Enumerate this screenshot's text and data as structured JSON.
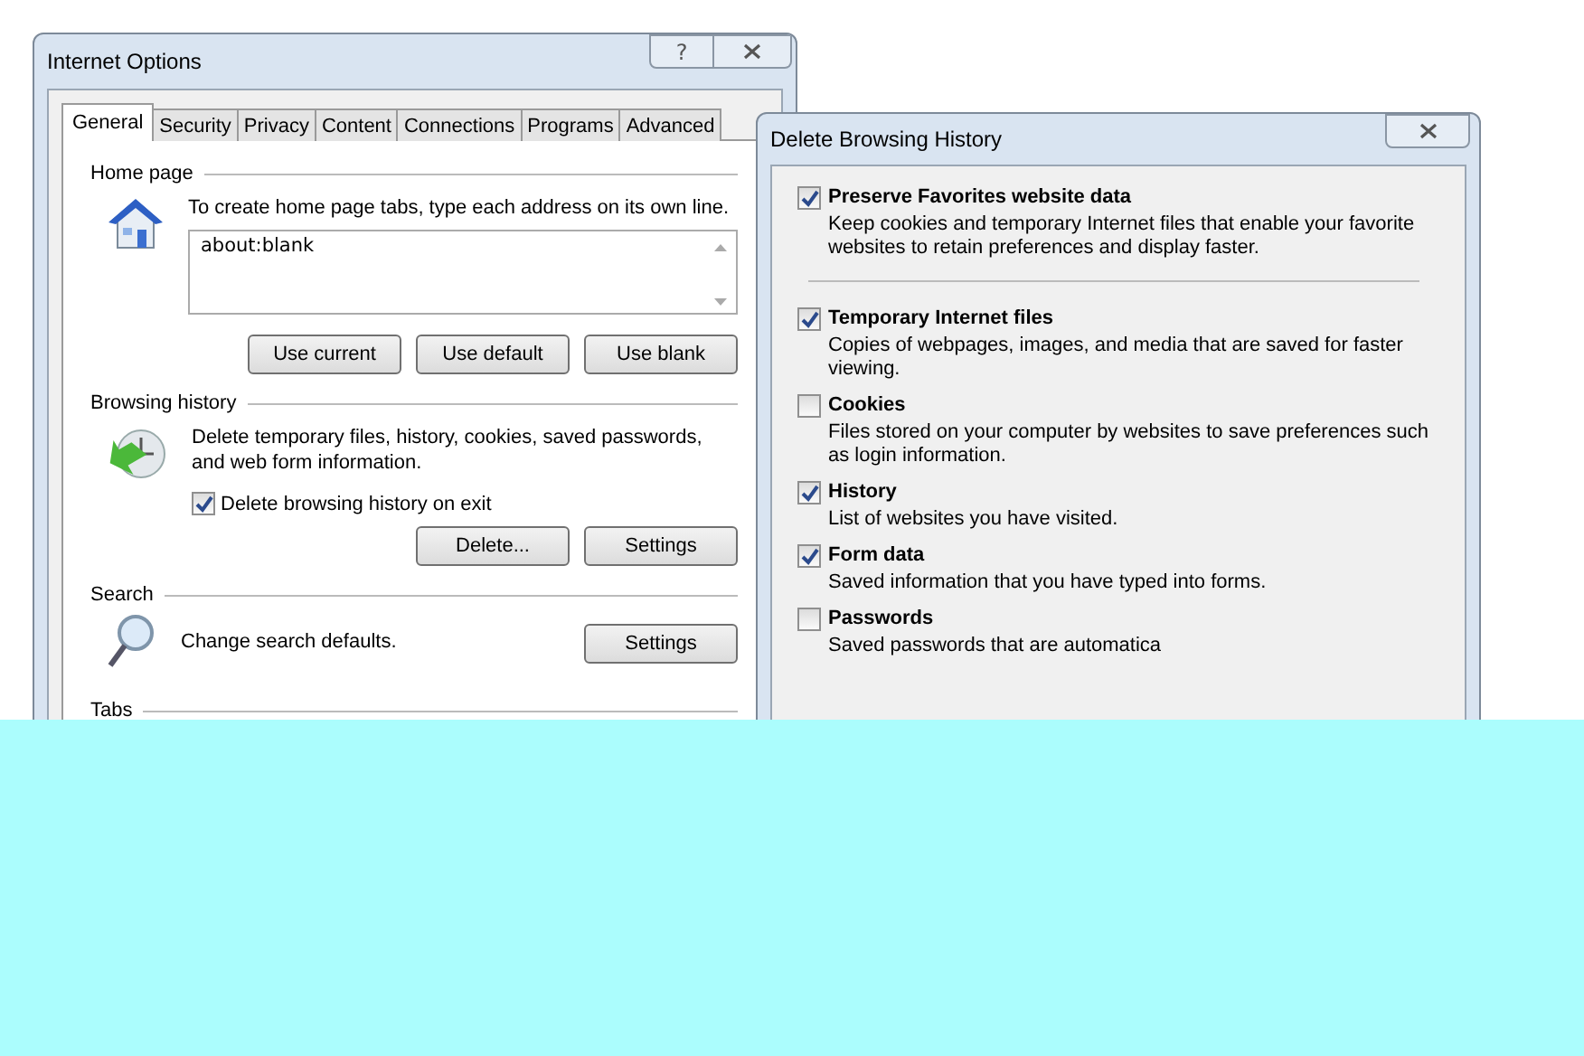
{
  "internet_options": {
    "title": "Internet Options",
    "help_button": "?",
    "tabs": [
      {
        "label": "General",
        "selected": true
      },
      {
        "label": "Security",
        "selected": false
      },
      {
        "label": "Privacy",
        "selected": false
      },
      {
        "label": "Content",
        "selected": false
      },
      {
        "label": "Connections",
        "selected": false
      },
      {
        "label": "Programs",
        "selected": false
      },
      {
        "label": "Advanced",
        "selected": false
      }
    ],
    "home_page": {
      "label": "Home page",
      "description": "To create home page tabs, type each address on its own line.",
      "address": "about:blank",
      "buttons": [
        "Use current",
        "Use default",
        "Use blank"
      ]
    },
    "browsing_history": {
      "label": "Browsing history",
      "description": "Delete temporary files, history, cookies, saved passwords, and web form information.",
      "checkbox": {
        "label": "Delete browsing history on exit",
        "checked": true
      },
      "buttons": [
        "Delete...",
        "Settings"
      ]
    },
    "search": {
      "label": "Search",
      "description": "Change search defaults.",
      "buttons": [
        "Settings"
      ]
    },
    "tabs_section": {
      "label": "Tabs"
    }
  },
  "delete_browsing_history": {
    "title": "Delete Browsing History",
    "preserve": {
      "title": "Preserve Favorites website data",
      "description": "Keep cookies and temporary Internet files that enable your favorite websites to retain preferences and display faster.",
      "checked": true
    },
    "options": [
      {
        "title": "Temporary Internet files",
        "description": "Copies of webpages, images, and media that are saved for faster viewing.",
        "checked": true
      },
      {
        "title": "Cookies",
        "description": "Files stored on your computer by websites to save preferences such as login information.",
        "checked": false
      },
      {
        "title": "History",
        "description": "List of websites you have visited.",
        "checked": true
      },
      {
        "title": "Form data",
        "description": "Saved information that you have typed into forms.",
        "checked": true
      },
      {
        "title": "Passwords",
        "description": "Saved passwords that are automatica",
        "checked": false
      }
    ]
  }
}
